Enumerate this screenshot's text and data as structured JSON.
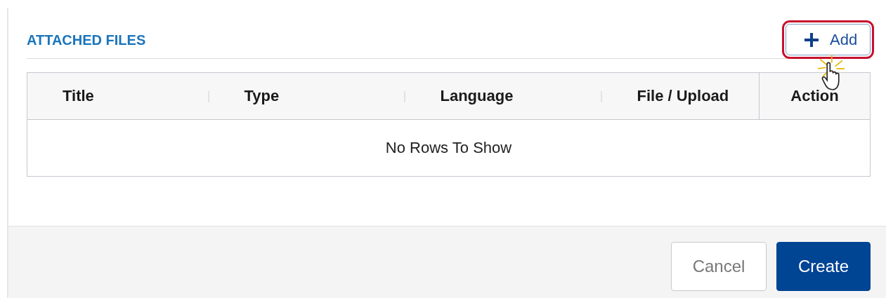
{
  "section": {
    "title": "ATTACHED FILES",
    "add_button": {
      "label": "Add",
      "highlighted": true
    }
  },
  "table": {
    "columns": [
      {
        "label": "Title",
        "kind": "data"
      },
      {
        "label": "Type",
        "kind": "data"
      },
      {
        "label": "Language",
        "kind": "data"
      },
      {
        "label": "File / Upload",
        "kind": "data"
      },
      {
        "label": "Action",
        "kind": "action"
      }
    ],
    "empty_message": "No Rows To Show"
  },
  "footer": {
    "buttons": [
      {
        "label": "Cancel",
        "kind": "secondary"
      },
      {
        "label": "Create",
        "kind": "primary"
      }
    ]
  }
}
